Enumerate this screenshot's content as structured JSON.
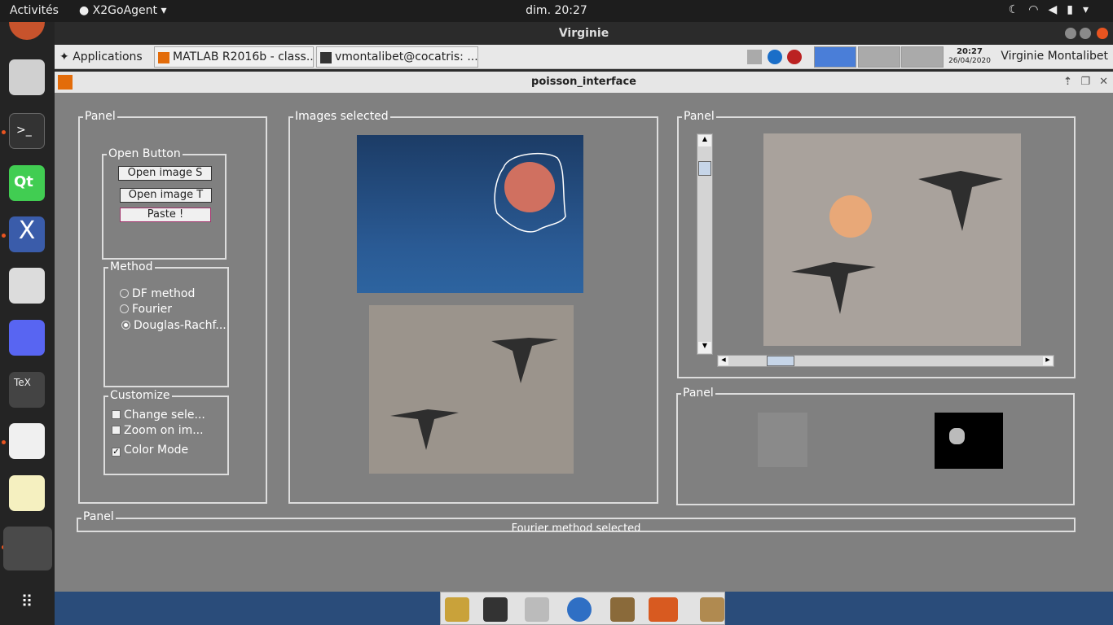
{
  "topbar": {
    "activities": "Activités",
    "app_menu": "X2GoAgent",
    "clock": "dim. 20:27"
  },
  "window": {
    "title": "Virginie"
  },
  "taskbar": {
    "applications": "Applications",
    "tasks": [
      "MATLAB R2016b - class...",
      "vmontalibet@cocatris: ..."
    ],
    "time": "20:27",
    "date": "26/04/2020",
    "user": "Virginie Montalibet"
  },
  "figure": {
    "title": "poisson_interface",
    "panel_left": {
      "label": "Panel",
      "open_group": {
        "label": "Open Button",
        "buttons": [
          "Open image S",
          "Open image T",
          "Paste !"
        ]
      },
      "method_group": {
        "label": "Method",
        "options": [
          "DF method",
          "Fourier",
          "Douglas-Rachf..."
        ],
        "selected": "Douglas-Rachf..."
      },
      "customize_group": {
        "label": "Customize",
        "checkboxes": [
          {
            "label": "Change sele...",
            "checked": false
          },
          {
            "label": "Zoom on im...",
            "checked": false
          },
          {
            "label": "Color Mode",
            "checked": true
          }
        ]
      }
    },
    "panel_images": {
      "label": "Images selected"
    },
    "panel_result": {
      "label": "Panel"
    },
    "panel_masks": {
      "label": "Panel"
    },
    "panel_status": {
      "label": "Panel",
      "text": "Fourier method selected"
    }
  }
}
